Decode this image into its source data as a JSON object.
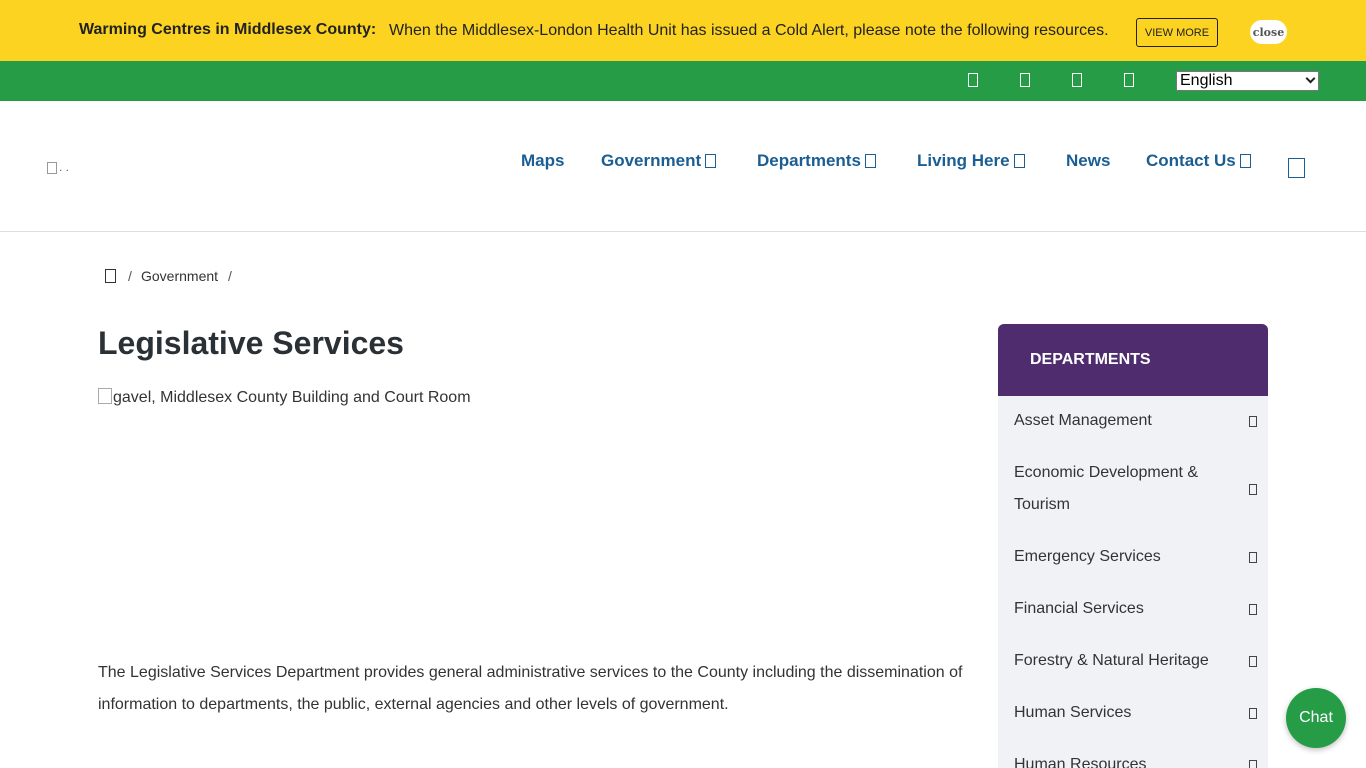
{
  "alert": {
    "title": "Warming Centres in Middlesex County:",
    "text": "When the Middlesex-London Health Unit has issued a Cold Alert, please note the following resources.",
    "view_more": "VIEW MORE",
    "close": "close"
  },
  "utility": {
    "icons": [
      "social-icon",
      "social-icon",
      "social-icon",
      "social-icon"
    ],
    "language": "English"
  },
  "header": {
    "logo_alt": ". ."
  },
  "nav": {
    "items": [
      {
        "label": "Maps",
        "has_dropdown": false
      },
      {
        "label": "Government",
        "has_dropdown": true
      },
      {
        "label": "Departments",
        "has_dropdown": true
      },
      {
        "label": "Living Here",
        "has_dropdown": true
      },
      {
        "label": "News",
        "has_dropdown": false
      },
      {
        "label": "Contact Us",
        "has_dropdown": true
      }
    ]
  },
  "breadcrumb": {
    "separator": "/",
    "items": [
      "Government"
    ]
  },
  "main": {
    "title": "Legislative Services",
    "image_alt": "gavel, Middlesex County Building and Court Room",
    "intro": "The Legislative Services Department provides general administrative services to the County including the dissemination of information to departments, the public, external agencies and other levels of government."
  },
  "sidebar": {
    "heading": "DEPARTMENTS",
    "items": [
      {
        "label": "Asset Management"
      },
      {
        "label": "Economic Development & Tourism"
      },
      {
        "label": "Emergency Services"
      },
      {
        "label": "Financial Services"
      },
      {
        "label": "Forestry & Natural Heritage"
      },
      {
        "label": "Human Services"
      },
      {
        "label": "Human Resources"
      }
    ]
  },
  "chat": {
    "label": "Chat"
  },
  "colors": {
    "alert_bg": "#fcd321",
    "green": "#269c47",
    "nav_blue": "#1b5e93",
    "purple": "#4e2c6d",
    "sidebar_bg": "#f0f2f5"
  }
}
